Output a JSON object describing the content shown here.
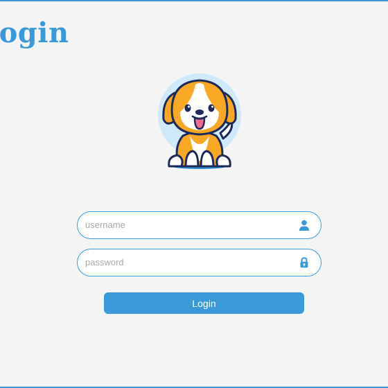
{
  "page": {
    "title": "Login"
  },
  "mascot": {
    "icon": "puppy-mascot-illustration"
  },
  "form": {
    "username": {
      "value": "",
      "placeholder": "username",
      "icon": "user-icon"
    },
    "password": {
      "value": "",
      "placeholder": "password",
      "icon": "lock-icon"
    },
    "submit_label": "Login"
  },
  "colors": {
    "accent": "#3a9ad9",
    "background": "#f4f4f5",
    "mascot_fur": "#f9a825",
    "mascot_outline": "#1e2a5a"
  }
}
